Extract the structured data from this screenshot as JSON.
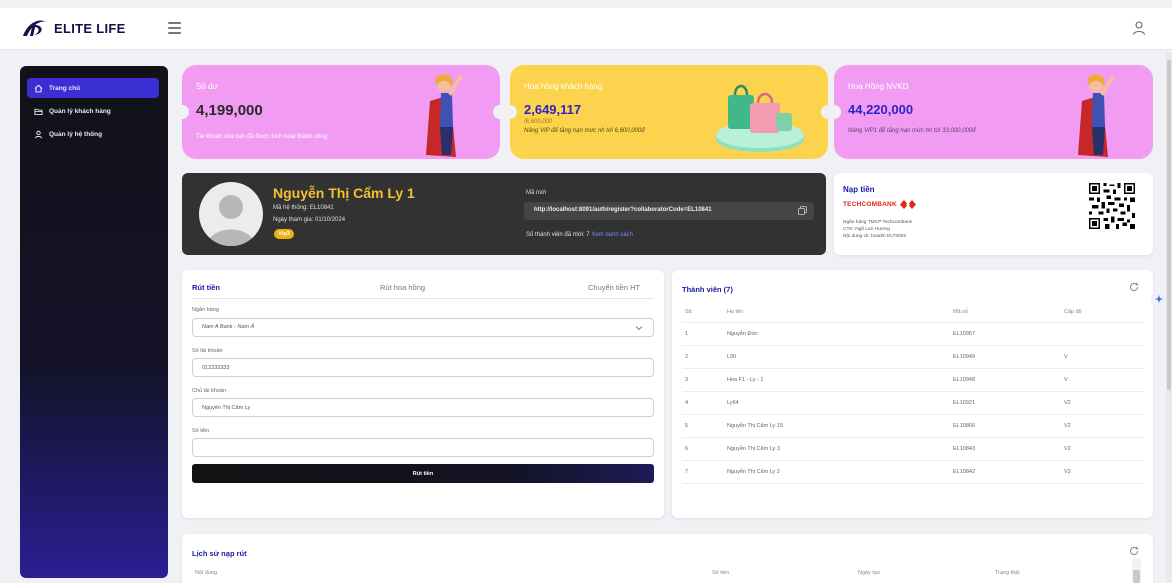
{
  "app": {
    "logo_text": "ELITE LIFE"
  },
  "sidebar": {
    "items": [
      {
        "label": "Trang chủ",
        "icon": "home-icon",
        "active": true
      },
      {
        "label": "Quản lý khách hàng",
        "icon": "folder-icon",
        "active": false
      },
      {
        "label": "Quản lý hệ thống",
        "icon": "user-icon",
        "active": false
      }
    ]
  },
  "stats": [
    {
      "label": "Số dư",
      "value": "4,199,000",
      "sub": "",
      "note": "Tài khoản của bạn đã được kích hoạt thành công",
      "bg": "#f19cf2"
    },
    {
      "label": "Hoa hồng khách hàng",
      "value": "2,649,117",
      "sub": "/6,600,000",
      "note": "Nâng VIP để tăng hạn mức nh tới 6,600,000đ",
      "bg": "#fcd34d"
    },
    {
      "label": "Hoa Hồng NVKD",
      "value": "44,220,000",
      "sub": "",
      "note": "Nâng VIP1 để tăng hạn mức hh tới 33,000,000đ",
      "bg": "#f19cf2"
    }
  ],
  "profile": {
    "name": "Nguyễn Thị Cẩm Ly 1",
    "system_code": "Mã hệ thống: EL10841",
    "join_date": "Ngày tham gia: 01/10/2024",
    "vip": "Vip3",
    "invite_label": "Mã mời",
    "invite_url": "http://localhost:8091/auth/register?collaboratorCode=EL10841",
    "member_count_text": "Số thành viên đã mời: 7",
    "view_list_link": "Xem danh sách"
  },
  "deposit": {
    "title": "Nạp tiền",
    "bank_brand": "TECHCOMBANK",
    "bank_name": "Ngân hàng TMCP Techcombank",
    "account_holder": "CTK: Ngô Lan Hương",
    "transfer_note": "Nội dung ck: hoadm ELT0002"
  },
  "withdraw": {
    "tabs": [
      "Rút tiền",
      "Rút hoa hồng",
      "Chuyển tiền HT"
    ],
    "bank_label": "Ngân hàng",
    "bank_value": "Nam A Bank - Nam Á",
    "account_number_label": "Số tài khoản",
    "account_number_value": "012333333",
    "account_holder_label": "Chủ tài khoản",
    "account_holder_value": "Nguyễn Thị Cẩm Ly",
    "amount_label": "Số tiền",
    "amount_value": "",
    "submit_label": "Rút tiền"
  },
  "members": {
    "title": "Thành viên (7)",
    "columns": [
      "Stt",
      "Họ tên",
      "Mã số",
      "Cấp độ"
    ],
    "rows": [
      [
        "1",
        "Nguyễn Đức",
        "EL10957",
        ""
      ],
      [
        "2",
        "L90",
        "EL10949",
        "V"
      ],
      [
        "3",
        "Hoa F1 - Ly - 1",
        "EL10948",
        "V"
      ],
      [
        "4",
        "Ly64",
        "EL10921",
        "V2"
      ],
      [
        "5",
        "Nguyễn Thị Cẩm Ly 15",
        "EL10866",
        "V2"
      ],
      [
        "6",
        "Nguyễn Thị Cẩm Ly 3",
        "EL10843",
        "V2"
      ],
      [
        "7",
        "Nguyễn Thị Cẩm Ly 2",
        "EL10842",
        "V2"
      ]
    ]
  },
  "history": {
    "title": "Lịch sử nạp rút",
    "columns": [
      "Nội dung",
      "Số tiền",
      "Ngày tạo",
      "Trạng thái"
    ]
  },
  "colors": {
    "accent": "#1a1aa0",
    "gold": "#f2c230",
    "sidebar_active": "#3b2fd4"
  }
}
